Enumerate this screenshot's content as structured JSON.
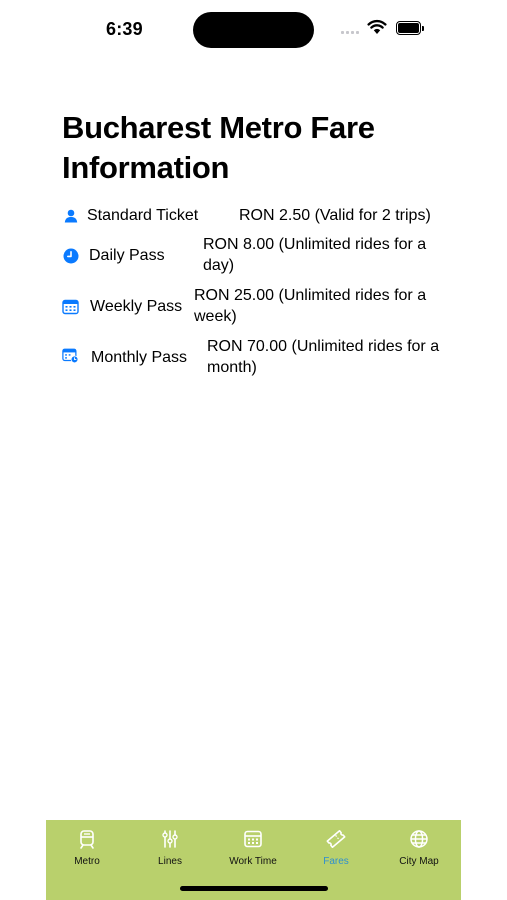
{
  "status": {
    "time": "6:39"
  },
  "page": {
    "title": "Bucharest Metro Fare Information"
  },
  "fares": [
    {
      "icon": "person-icon",
      "name": "Standard Ticket",
      "price": "RON 2.50 (Valid for 2 trips)"
    },
    {
      "icon": "clock-icon",
      "name": "Daily Pass",
      "price": "RON 8.00 (Unlimited rides for a day)"
    },
    {
      "icon": "calendar-icon",
      "name": "Weekly Pass",
      "price": "RON 25.00 (Unlimited rides for a week)"
    },
    {
      "icon": "calendar-badge-icon",
      "name": "Monthly Pass",
      "price": "RON 70.00 (Unlimited rides for a month)"
    }
  ],
  "tabs": [
    {
      "label": "Metro",
      "icon": "tram-icon",
      "active": false
    },
    {
      "label": "Lines",
      "icon": "sliders-icon",
      "active": false
    },
    {
      "label": "Work Time",
      "icon": "calendar-icon",
      "active": false
    },
    {
      "label": "Fares",
      "icon": "ticket-icon",
      "active": true
    },
    {
      "label": "City Map",
      "icon": "globe-icon",
      "active": false
    }
  ],
  "colors": {
    "accent": "#0a7aff",
    "tab_bar": "#b9d06c",
    "tab_active": "#2f8fd0",
    "tab_inactive_icon": "#ffffff"
  }
}
